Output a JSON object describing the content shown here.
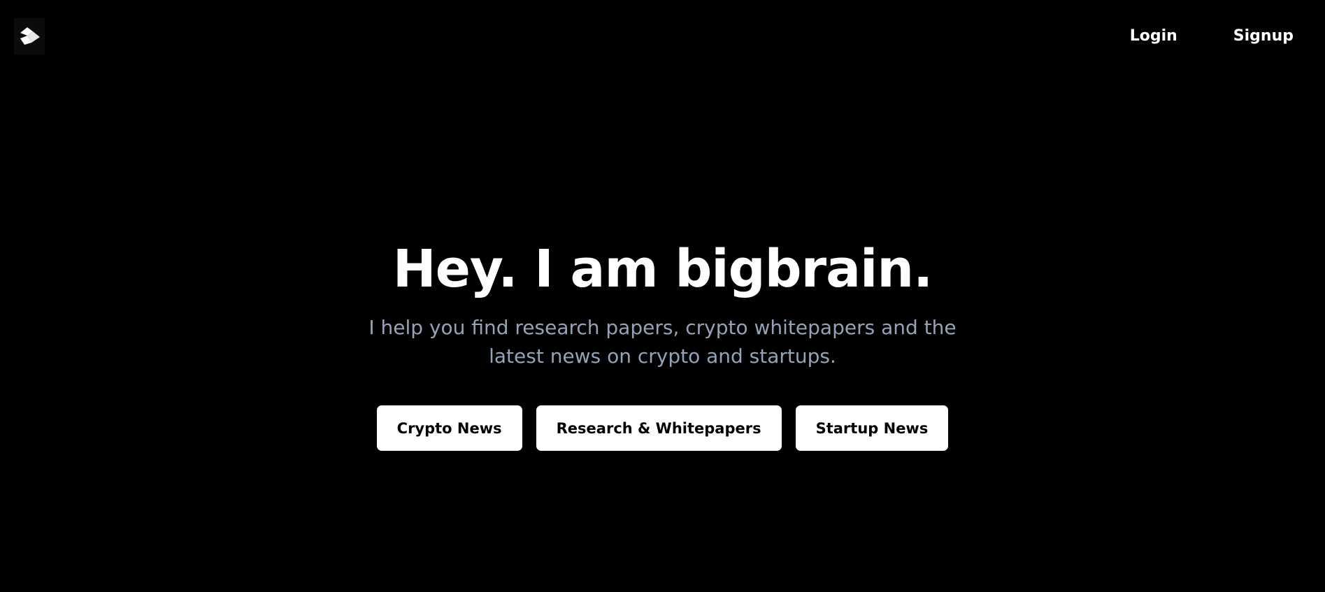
{
  "header": {
    "logo_icon": "brain-logo-icon",
    "nav": {
      "login_label": "Login",
      "signup_label": "Signup"
    }
  },
  "hero": {
    "headline": "Hey. I am bigbrain.",
    "subtitle": "I help you find research papers, crypto whitepapers and the latest news on crypto and startups.",
    "buttons": [
      {
        "label": "Crypto News"
      },
      {
        "label": "Research & Whitepapers"
      },
      {
        "label": "Startup News"
      }
    ]
  },
  "colors": {
    "background": "#000000",
    "text": "#ffffff",
    "subtitle": "#94a3b8",
    "button_bg": "#ffffff",
    "button_text": "#000000"
  }
}
